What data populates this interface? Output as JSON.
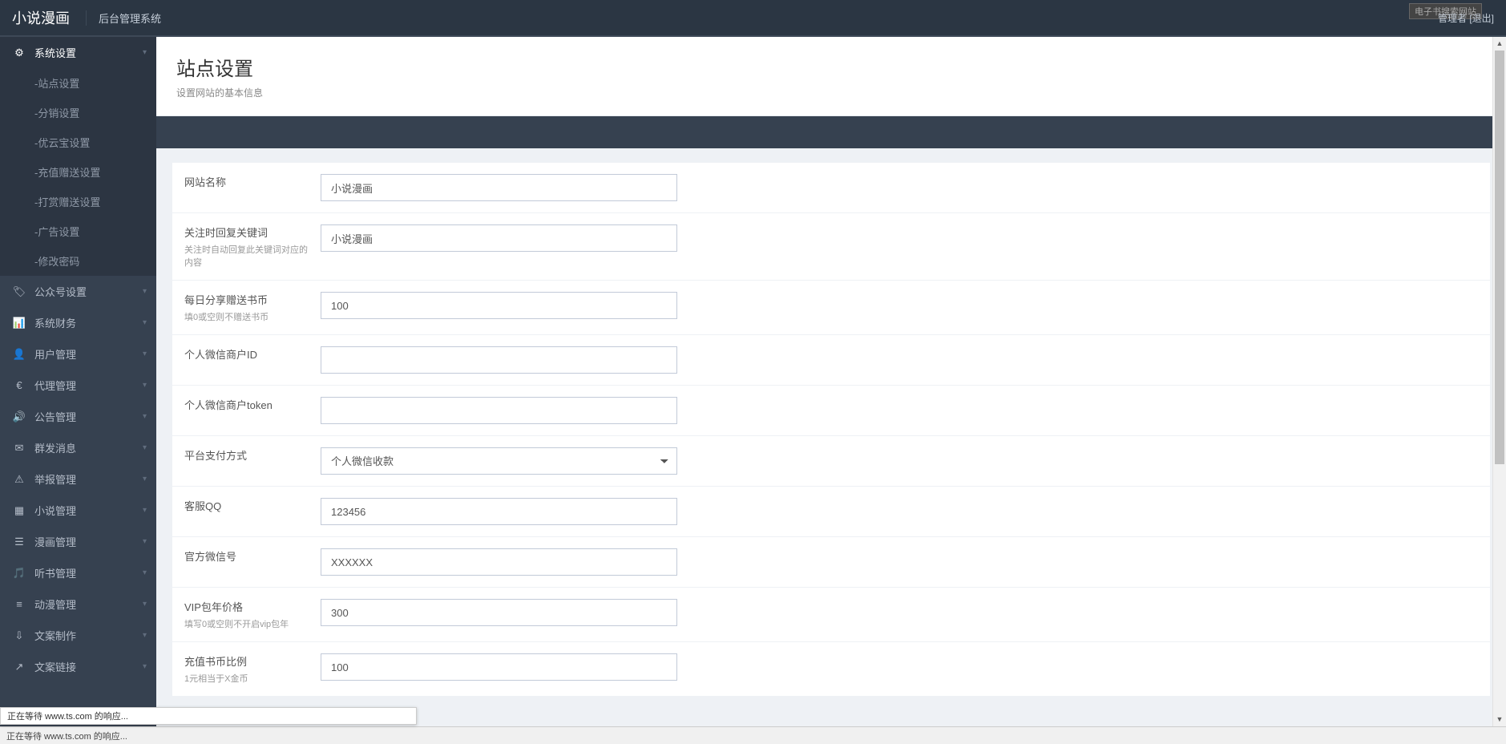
{
  "header": {
    "brand": "小说漫画",
    "subsystem": "后台管理系统",
    "user_label": "管理者",
    "logout_label": "[退出]",
    "badge": "电子书搜索网站"
  },
  "page": {
    "title": "站点设置",
    "description": "设置网站的基本信息"
  },
  "sidebar": {
    "items": [
      {
        "icon": "⚙",
        "label": "系统设置",
        "expandable": true,
        "expanded": true
      },
      {
        "icon": "🏷",
        "label": "公众号设置",
        "expandable": true
      },
      {
        "icon": "📊",
        "label": "系统财务",
        "expandable": true
      },
      {
        "icon": "👤",
        "label": "用户管理",
        "expandable": true
      },
      {
        "icon": "€",
        "label": "代理管理",
        "expandable": true
      },
      {
        "icon": "🔊",
        "label": "公告管理",
        "expandable": true
      },
      {
        "icon": "✉",
        "label": "群发消息",
        "expandable": true
      },
      {
        "icon": "⚠",
        "label": "举报管理",
        "expandable": true
      },
      {
        "icon": "▦",
        "label": "小说管理",
        "expandable": true
      },
      {
        "icon": "☰",
        "label": "漫画管理",
        "expandable": true
      },
      {
        "icon": "🎵",
        "label": "听书管理",
        "expandable": true
      },
      {
        "icon": "≡",
        "label": "动漫管理",
        "expandable": true
      },
      {
        "icon": "⇩",
        "label": "文案制作",
        "expandable": true
      },
      {
        "icon": "↗",
        "label": "文案链接",
        "expandable": true
      }
    ],
    "submenu": [
      "-站点设置",
      "-分销设置",
      "-优云宝设置",
      "-充值赠送设置",
      "-打赏赠送设置",
      "-广告设置",
      "-修改密码"
    ]
  },
  "form": {
    "rows": [
      {
        "label": "网站名称",
        "sub": "",
        "value": "小说漫画",
        "type": "text"
      },
      {
        "label": "关注时回复关键词",
        "sub": "关注时自动回复此关键词对应的内容",
        "value": "小说漫画",
        "type": "text"
      },
      {
        "label": "每日分享赠送书币",
        "sub": "填0或空则不赠送书币",
        "value": "100",
        "type": "text"
      },
      {
        "label": "个人微信商户ID",
        "sub": "",
        "value": "",
        "type": "text"
      },
      {
        "label": "个人微信商户token",
        "sub": "",
        "value": "",
        "type": "text"
      },
      {
        "label": "平台支付方式",
        "sub": "",
        "value": "个人微信收款",
        "type": "select"
      },
      {
        "label": "客服QQ",
        "sub": "",
        "value": "123456",
        "type": "text"
      },
      {
        "label": "官方微信号",
        "sub": "",
        "value": "XXXXXX",
        "type": "text"
      },
      {
        "label": "VIP包年价格",
        "sub": "填写0或空则不开启vip包年",
        "value": "300",
        "type": "text"
      },
      {
        "label": "充值书币比例",
        "sub": "1元相当于X金币",
        "value": "100",
        "type": "text"
      }
    ]
  },
  "status": {
    "waiting": "正在等待 www.ts.com 的响应..."
  }
}
